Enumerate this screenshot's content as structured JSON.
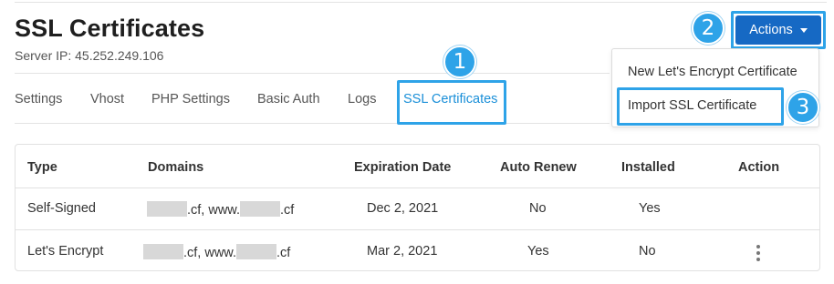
{
  "header": {
    "title": "SSL Certificates",
    "server_ip": "Server IP: 45.252.249.106"
  },
  "actions": {
    "label": "Actions",
    "dropdown": [
      "New Let's Encrypt Certificate",
      "Import SSL Certificate"
    ]
  },
  "tabs": [
    "Settings",
    "Vhost",
    "PHP Settings",
    "Basic Auth",
    "Logs",
    "SSL Certificates"
  ],
  "active_tab": "SSL Certificates",
  "callouts": [
    "1",
    "2",
    "3"
  ],
  "table": {
    "columns": [
      "Type",
      "Domains",
      "Expiration Date",
      "Auto Renew",
      "Installed",
      "Action"
    ],
    "rows": [
      {
        "type": "Self-Signed",
        "domain_a": ".cf, www.",
        "domain_b": ".cf",
        "expiration": "Dec 2, 2021",
        "auto_renew": "No",
        "installed": "Yes"
      },
      {
        "type": "Let's Encrypt",
        "domain_a": ".cf, www.",
        "domain_b": ".cf",
        "expiration": "Mar 2, 2021",
        "auto_renew": "Yes",
        "installed": "No"
      }
    ]
  },
  "colors": {
    "accent": "#1a8fd8",
    "callout": "#2ea3e8",
    "primary_button": "#1669c4"
  }
}
